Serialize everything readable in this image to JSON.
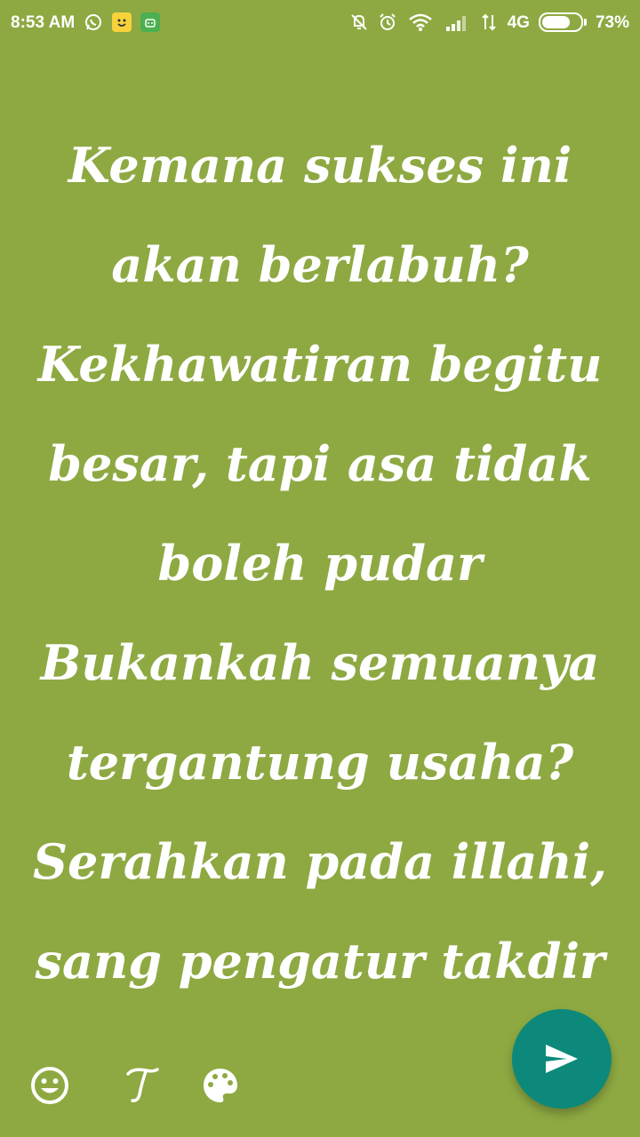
{
  "status_bar": {
    "time": "8:53 AM",
    "left_icons": [
      "whatsapp-icon",
      "yellow-face-app-icon",
      "green-app-icon"
    ],
    "right_icons": [
      "bell-off-icon",
      "alarm-icon",
      "wifi-icon",
      "signal-icon",
      "data-arrows-icon"
    ],
    "network": "4G",
    "battery_percent": "73%",
    "battery_level": 0.73
  },
  "content": {
    "lines": [
      "Kemana sukses ini",
      "akan berlabuh?",
      "Kekhawatiran begitu",
      "besar, tapi asa tidak",
      "boleh pudar",
      "Bukankah semuanya",
      "tergantung usaha?",
      "Serahkan pada illahi,",
      "sang pengatur takdir"
    ]
  },
  "toolbar": {
    "tools": [
      "emoji-icon",
      "text-style-icon",
      "palette-icon"
    ],
    "send_icon": "send-icon"
  },
  "colors": {
    "background": "#8ea942",
    "text": "#ffffff",
    "fab": "#0c897a"
  }
}
